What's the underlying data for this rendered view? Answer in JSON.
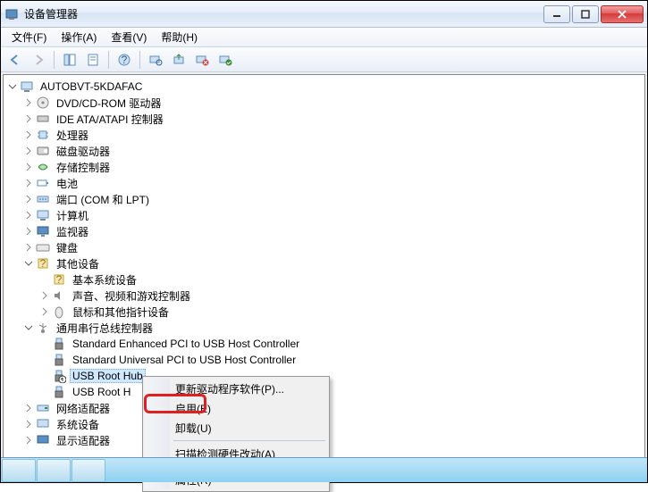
{
  "window": {
    "title": "设备管理器"
  },
  "menubar": [
    {
      "label": "文件(F)"
    },
    {
      "label": "操作(A)"
    },
    {
      "label": "查看(V)"
    },
    {
      "label": "帮助(H)"
    }
  ],
  "tree": {
    "root": "AUTOBVT-5KDAFAC",
    "items": [
      {
        "label": "DVD/CD-ROM 驱动器",
        "icon": "disc"
      },
      {
        "label": "IDE ATA/ATAPI 控制器",
        "icon": "ide"
      },
      {
        "label": "处理器",
        "icon": "cpu"
      },
      {
        "label": "磁盘驱动器",
        "icon": "disk"
      },
      {
        "label": "存储控制器",
        "icon": "storage"
      },
      {
        "label": "电池",
        "icon": "battery"
      },
      {
        "label": "端口 (COM 和 LPT)",
        "icon": "port"
      },
      {
        "label": "计算机",
        "icon": "computer"
      },
      {
        "label": "监视器",
        "icon": "monitor"
      },
      {
        "label": "键盘",
        "icon": "keyboard"
      }
    ],
    "other_devices": {
      "label": "其他设备",
      "children": [
        {
          "label": "基本系统设备"
        },
        {
          "label": "声音、视频和游戏控制器"
        },
        {
          "label": "鼠标和其他指针设备"
        }
      ]
    },
    "usb": {
      "label": "通用串行总线控制器",
      "children": [
        {
          "label": "Standard Enhanced PCI to USB Host Controller"
        },
        {
          "label": "Standard Universal PCI to USB Host Controller"
        },
        {
          "label": "USB Root Hub",
          "selected": true,
          "disabled": true
        },
        {
          "label": "USB Root H"
        }
      ]
    },
    "tail": [
      {
        "label": "网络适配器",
        "icon": "network"
      },
      {
        "label": "系统设备",
        "icon": "system"
      },
      {
        "label": "显示适配器",
        "icon": "display"
      }
    ]
  },
  "context_menu": [
    {
      "label": "更新驱动程序软件(P)..."
    },
    {
      "label": "启用(E)",
      "highlight": true
    },
    {
      "label": "卸载(U)"
    },
    {
      "sep": true
    },
    {
      "label": "扫描检测硬件改动(A)"
    },
    {
      "sep": true
    },
    {
      "label": "属性(R)"
    }
  ]
}
